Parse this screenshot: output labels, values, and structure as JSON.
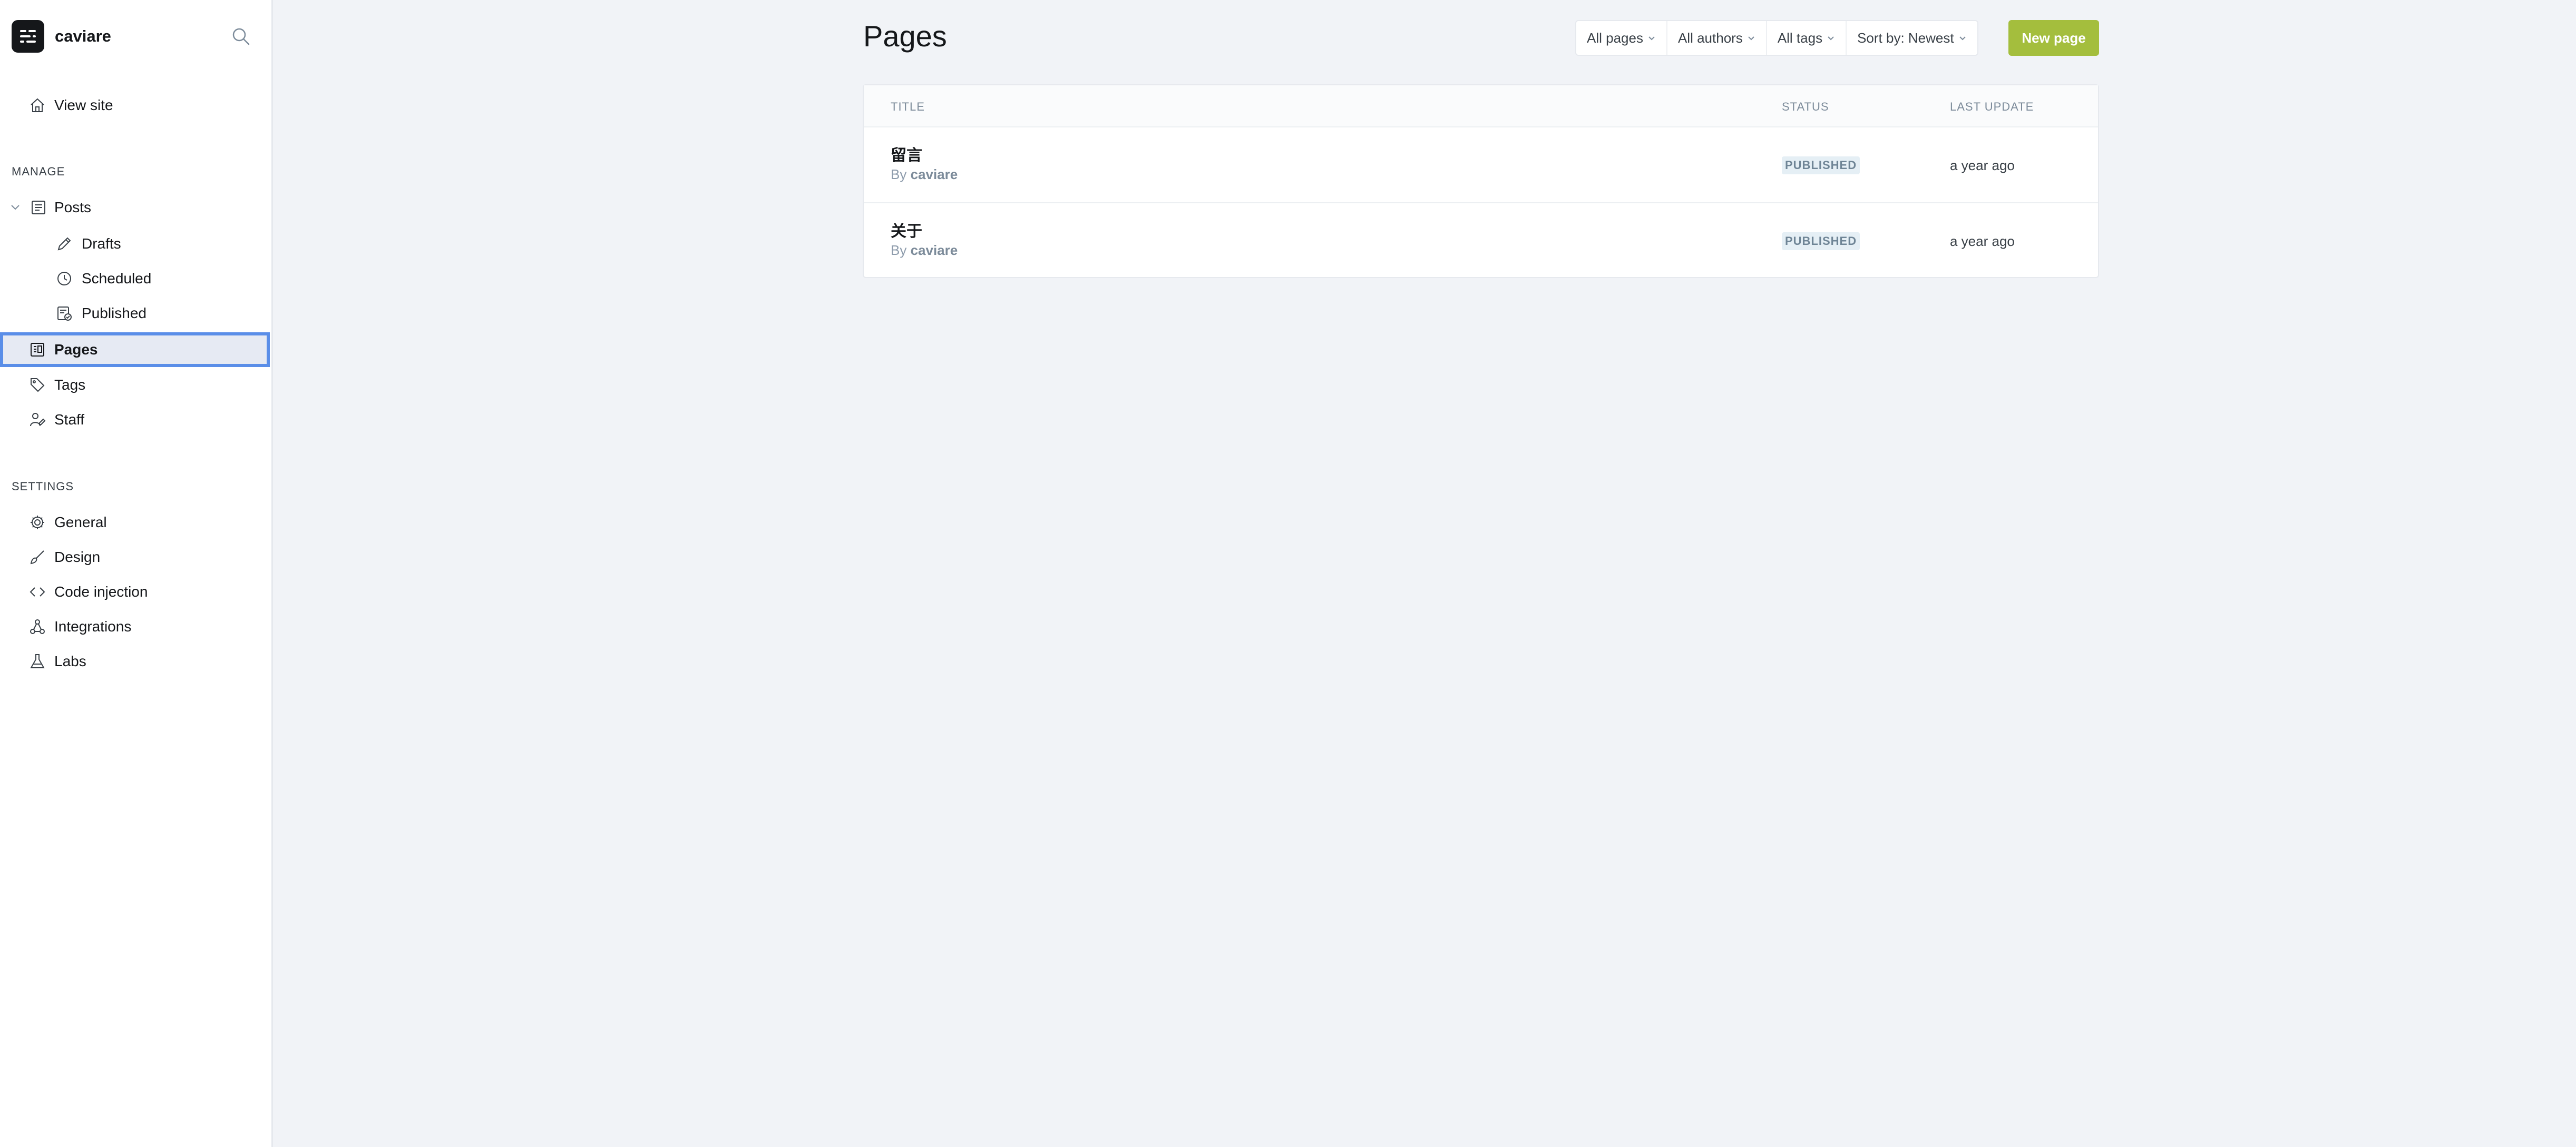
{
  "brand": {
    "name": "caviare"
  },
  "nav": {
    "view_site": "View site",
    "manage_title": "MANAGE",
    "posts": "Posts",
    "drafts": "Drafts",
    "scheduled": "Scheduled",
    "published": "Published",
    "pages": "Pages",
    "tags": "Tags",
    "staff": "Staff",
    "settings_title": "SETTINGS",
    "general": "General",
    "design": "Design",
    "code_injection": "Code injection",
    "integrations": "Integrations",
    "labs": "Labs"
  },
  "main": {
    "title": "Pages",
    "filters": {
      "type": "All pages",
      "authors": "All authors",
      "tags": "All tags",
      "sort": "Sort by: Newest"
    },
    "new_page_label": "New page",
    "table": {
      "headers": {
        "title": "TITLE",
        "status": "STATUS",
        "last_update": "LAST UPDATE"
      },
      "rows": [
        {
          "title": "留言",
          "by": "By",
          "author": "caviare",
          "status": "PUBLISHED",
          "updated": "a year ago"
        },
        {
          "title": "关于",
          "by": "By",
          "author": "caviare",
          "status": "PUBLISHED",
          "updated": "a year ago"
        }
      ]
    }
  },
  "colors": {
    "accent": "#a4be3d",
    "active_outline": "#5a8ee8",
    "active_bg": "#e6eaf3",
    "badge_bg": "#e5eff5"
  },
  "icons": {
    "brand": "ghost-logo-icon",
    "search": "search-icon",
    "view_site": "home-icon",
    "posts": "posts-icon",
    "drafts": "pencil-icon",
    "scheduled": "clock-icon",
    "published": "published-icon",
    "pages": "pages-icon",
    "tags": "tag-icon",
    "staff": "staff-icon",
    "general": "gear-icon",
    "design": "brush-icon",
    "code_injection": "code-icon",
    "integrations": "integrations-icon",
    "labs": "flask-icon"
  }
}
